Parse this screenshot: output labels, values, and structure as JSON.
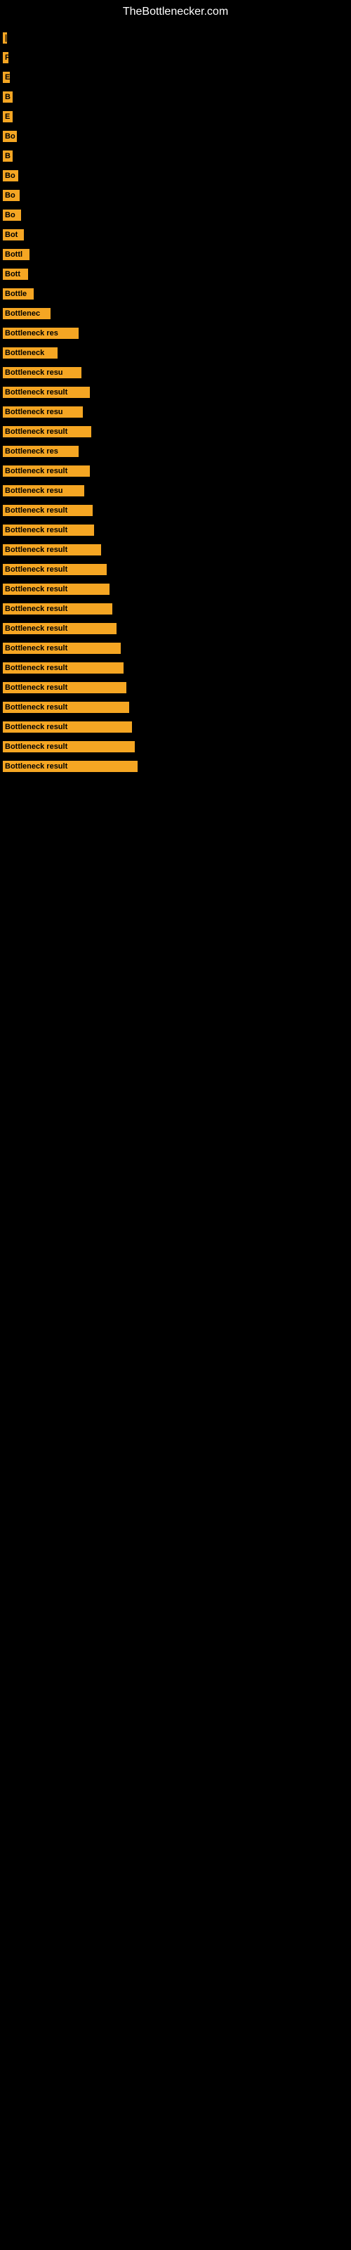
{
  "site": {
    "title": "TheBottlenecker.com"
  },
  "bars": [
    {
      "label": "|",
      "width": 4
    },
    {
      "label": "P",
      "width": 8
    },
    {
      "label": "E",
      "width": 10
    },
    {
      "label": "B",
      "width": 14
    },
    {
      "label": "E",
      "width": 14
    },
    {
      "label": "Bo",
      "width": 20
    },
    {
      "label": "B",
      "width": 14
    },
    {
      "label": "Bo",
      "width": 22
    },
    {
      "label": "Bo",
      "width": 24
    },
    {
      "label": "Bo",
      "width": 26
    },
    {
      "label": "Bot",
      "width": 30
    },
    {
      "label": "Bottl",
      "width": 38
    },
    {
      "label": "Bott",
      "width": 36
    },
    {
      "label": "Bottle",
      "width": 44
    },
    {
      "label": "Bottlenec",
      "width": 68
    },
    {
      "label": "Bottleneck res",
      "width": 108
    },
    {
      "label": "Bottleneck",
      "width": 78
    },
    {
      "label": "Bottleneck resu",
      "width": 112
    },
    {
      "label": "Bottleneck result",
      "width": 124
    },
    {
      "label": "Bottleneck resu",
      "width": 114
    },
    {
      "label": "Bottleneck result",
      "width": 126
    },
    {
      "label": "Bottleneck res",
      "width": 108
    },
    {
      "label": "Bottleneck result",
      "width": 124
    },
    {
      "label": "Bottleneck resu",
      "width": 116
    },
    {
      "label": "Bottleneck result",
      "width": 128
    },
    {
      "label": "Bottleneck result",
      "width": 130
    },
    {
      "label": "Bottleneck result",
      "width": 140
    },
    {
      "label": "Bottleneck result",
      "width": 148
    },
    {
      "label": "Bottleneck result",
      "width": 152
    },
    {
      "label": "Bottleneck result",
      "width": 156
    },
    {
      "label": "Bottleneck result",
      "width": 162
    },
    {
      "label": "Bottleneck result",
      "width": 168
    },
    {
      "label": "Bottleneck result",
      "width": 172
    },
    {
      "label": "Bottleneck result",
      "width": 176
    },
    {
      "label": "Bottleneck result",
      "width": 180
    },
    {
      "label": "Bottleneck result",
      "width": 184
    },
    {
      "label": "Bottleneck result",
      "width": 188
    },
    {
      "label": "Bottleneck result",
      "width": 192
    }
  ]
}
